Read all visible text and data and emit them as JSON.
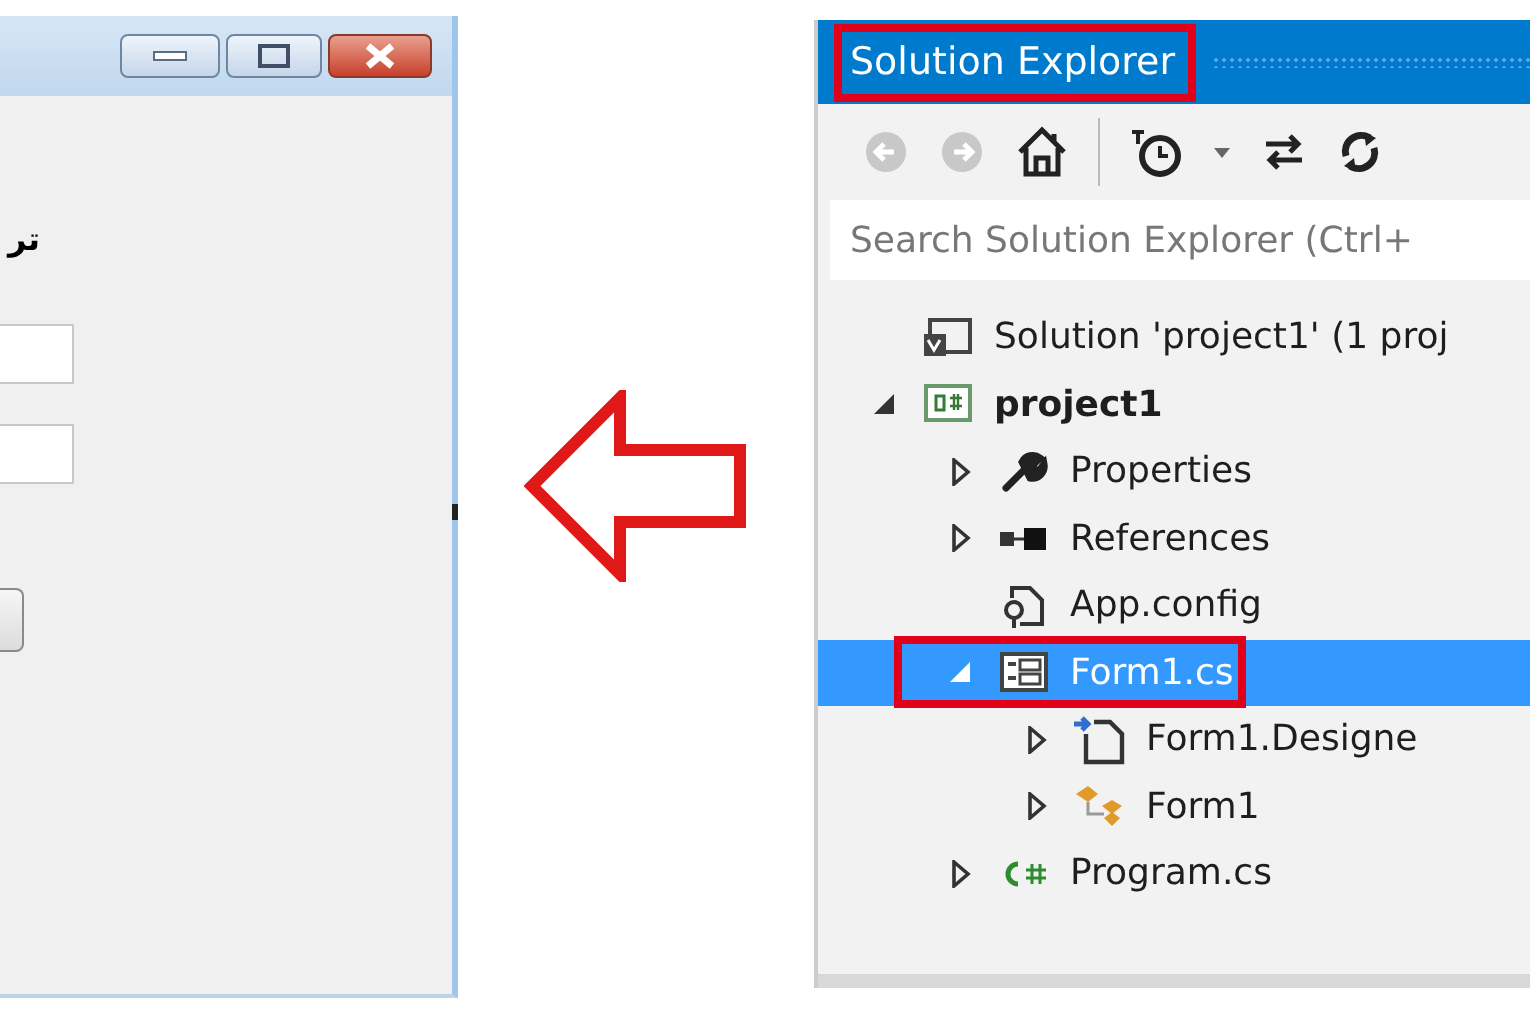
{
  "form_window": {
    "label": "تر"
  },
  "solution_explorer": {
    "title": "Solution Explorer",
    "title_highlighted": true,
    "search": {
      "placeholder": "Search Solution Explorer (Ctrl+"
    },
    "tree": [
      {
        "label": "Solution 'project1' (1 proj",
        "kind": "solution",
        "selected": false,
        "highlighted": false,
        "children": [
          {
            "label": "project1",
            "kind": "project",
            "expanded": true,
            "selected": false,
            "highlighted": false,
            "children": [
              {
                "label": "Properties",
                "kind": "properties",
                "expanded": false,
                "selected": false,
                "highlighted": false
              },
              {
                "label": "References",
                "kind": "references",
                "expanded": false,
                "selected": false,
                "highlighted": false
              },
              {
                "label": "App.config",
                "kind": "config",
                "selected": false,
                "highlighted": false
              },
              {
                "label": "Form1.cs",
                "kind": "form",
                "expanded": true,
                "selected": true,
                "highlighted": true,
                "children": [
                  {
                    "label": "Form1.Designe",
                    "kind": "designer",
                    "expanded": false,
                    "selected": false,
                    "highlighted": false
                  },
                  {
                    "label": "Form1",
                    "kind": "class",
                    "expanded": false,
                    "selected": false,
                    "highlighted": false
                  }
                ]
              },
              {
                "label": "Program.cs",
                "kind": "csharp",
                "expanded": false,
                "selected": false,
                "highlighted": false
              }
            ]
          }
        ]
      }
    ]
  }
}
